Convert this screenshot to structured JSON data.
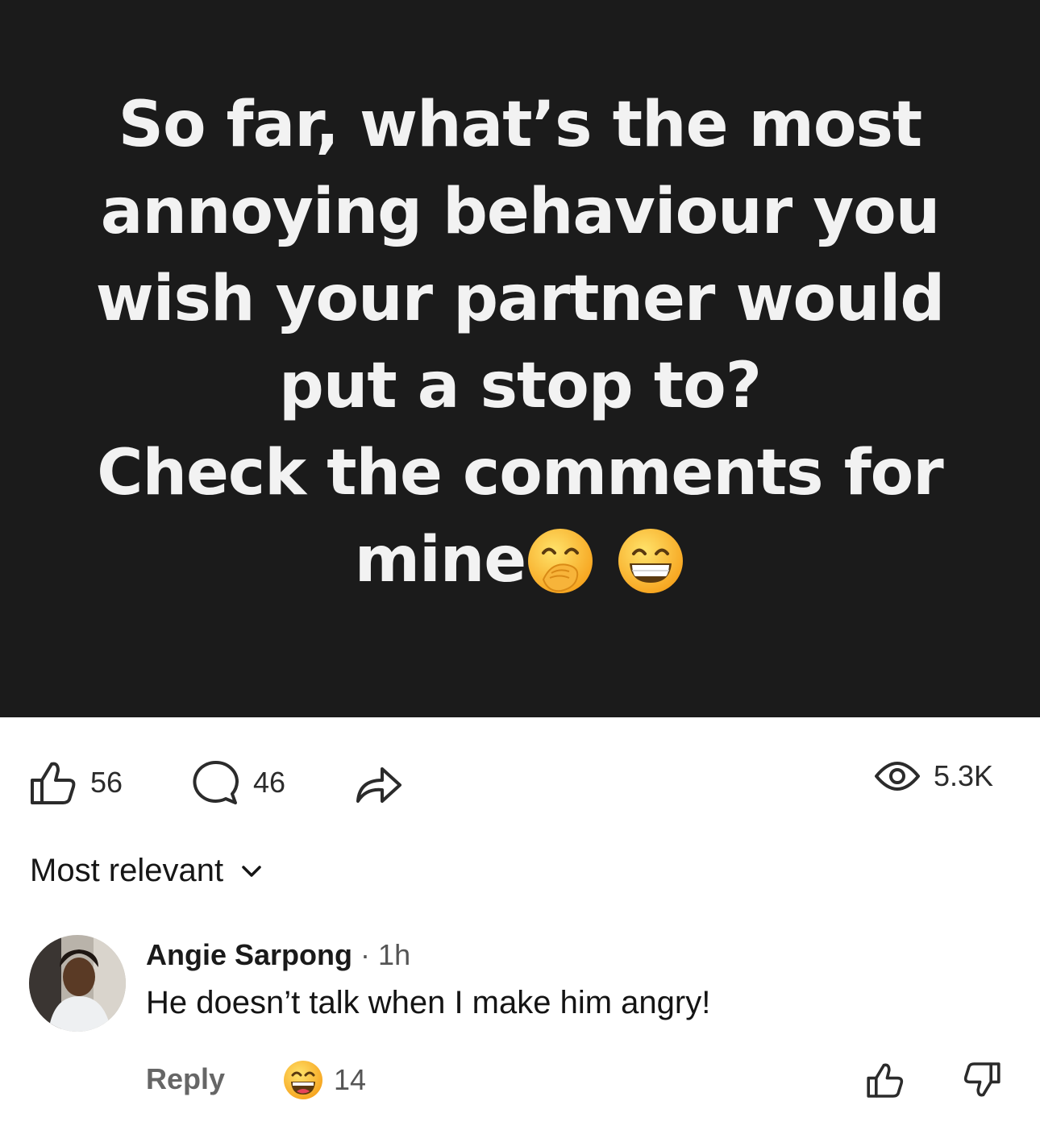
{
  "post": {
    "lines": [
      "So far, what’s the most",
      "annoying behaviour you",
      "wish your partner would",
      "put a stop to?",
      "Check the comments for",
      "mine"
    ],
    "trailing_emojis": [
      "hand-over-mouth-emoji",
      "grinning-face-emoji"
    ],
    "background": "#1b1b1b",
    "text_color": "#f2f2f2"
  },
  "stats": {
    "likes": "56",
    "comments": "46",
    "views": "5.3K",
    "icons": [
      "thumbs-up-icon",
      "comment-icon",
      "share-icon",
      "eye-icon"
    ]
  },
  "sort": {
    "label": "Most relevant",
    "icon": "chevron-down-icon"
  },
  "comment": {
    "author": "Angie Sarpong",
    "separator": "·",
    "time": "1h",
    "text": "He doesn’t talk when I make him angry!",
    "reply_label": "Reply",
    "reaction_count": "14",
    "reaction_icon": "laughing-face-emoji",
    "vote_icons": [
      "thumbs-up-icon",
      "thumbs-down-icon"
    ]
  }
}
